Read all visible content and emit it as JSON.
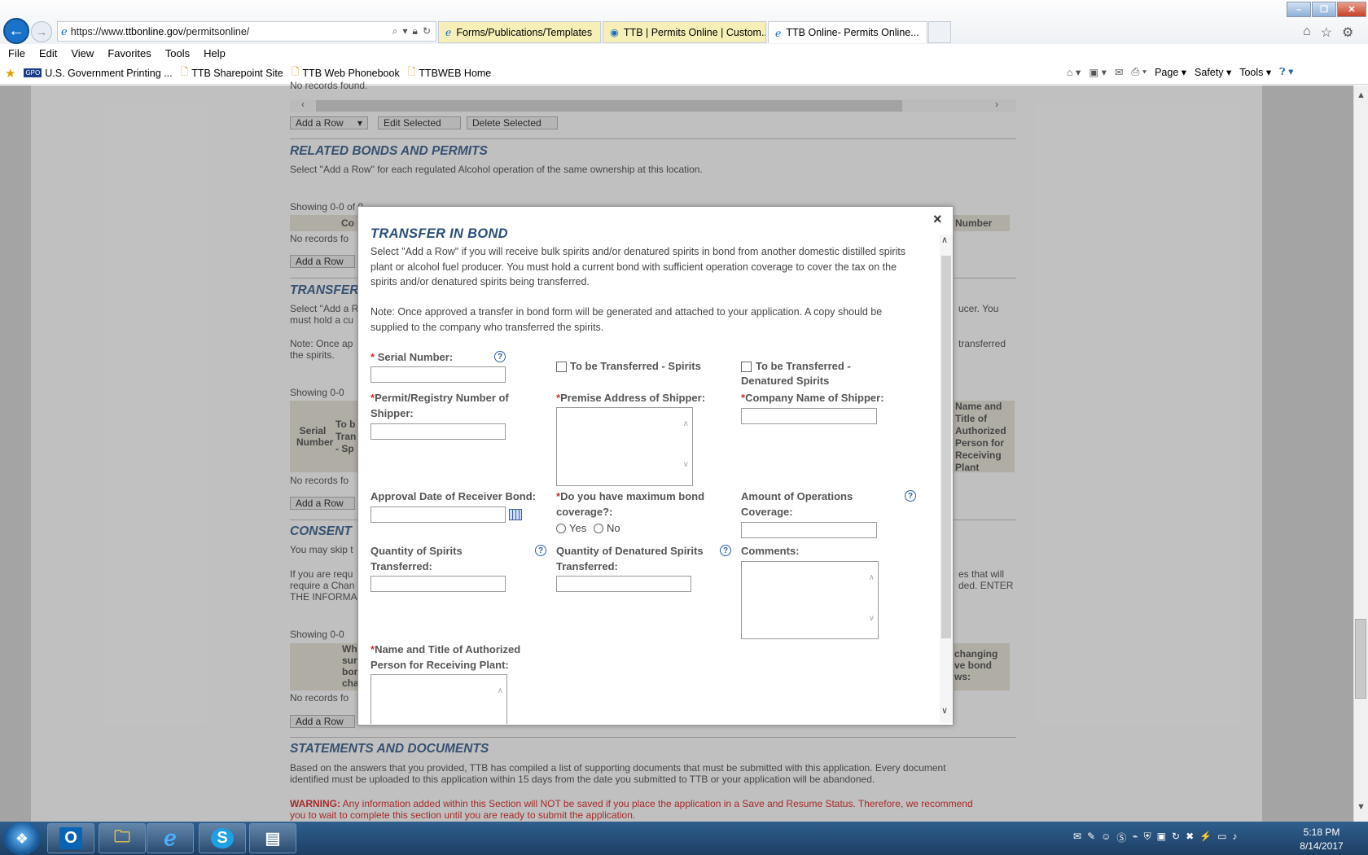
{
  "browser": {
    "url_prefix": "https://www.",
    "url_domain": "ttbonline.gov",
    "url_path": "/permitsonline/",
    "tabs": [
      "Forms/Publications/Templates",
      "TTB | Permits Online | Custom...",
      "TTB Online- Permits Online..."
    ],
    "menu": [
      "File",
      "Edit",
      "View",
      "Favorites",
      "Tools",
      "Help"
    ],
    "favorites": [
      "U.S. Government Printing ...",
      "TTB Sharepoint Site",
      "TTB Web Phonebook",
      "TTBWEB Home"
    ],
    "commands": [
      "Page",
      "Safety",
      "Tools"
    ]
  },
  "page": {
    "no_records_top": "No records found.",
    "btn_add_row": "Add a Row",
    "btn_edit_selected": "Edit Selected",
    "btn_delete_selected": "Delete Selected",
    "related_heading": "RELATED BONDS AND PERMITS",
    "related_desc": "Select \"Add a Row\" for each regulated Alcohol operation of the same ownership at this location.",
    "showing_0": "Showing 0-0 of 0",
    "showing_short": "Showing 0-0",
    "col_co": "Co",
    "col_number": "Number",
    "no_records_short": "No records fo",
    "transfer_heading": "TRANSFER",
    "transfer_desc_l1": "Select \"Add a R",
    "transfer_desc_l2": "must hold a cu",
    "transfer_right_1": "ucer. You",
    "note_l1": "Note: Once ap",
    "note_l2": "the spirits.",
    "note_right": "transferred",
    "col_serial": "Serial Number",
    "col_to_be_l1": "To b",
    "col_to_be_l2": "Tran",
    "col_to_be_l3": "- Sp",
    "col_name_title": "Name and Title of Authorized Person for Receiving Plant",
    "consent_heading": "CONSENT",
    "consent_l1": "You may skip t",
    "consent_l2": "If you are requ",
    "consent_l3": "require a Chan",
    "consent_l4": "THE INFORMA",
    "consent_right_1": "es that will",
    "consent_right_2": "ded. ENTER",
    "col_wh_1": "Wh",
    "col_wh_2": "sur",
    "col_wh_3": "bor",
    "col_wh_4": "cha",
    "col_changing_1": "changing",
    "col_changing_2": "ve bond",
    "col_changing_3": "ws:",
    "statements_heading": "STATEMENTS AND DOCUMENTS",
    "statements_l1": "Based on the answers that you provided, TTB has compiled a list of supporting documents that must be submitted with this application. Every document",
    "statements_l2": "identified must be uploaded to this application within 15 days from the date you submitted to TTB or your application will be abandoned.",
    "warning_label": "WARNING:",
    "warning_l1": " Any information added within this Section will NOT be saved if you place the application in a Save and Resume Status. Therefore, we recommend",
    "warning_l2": "you to wait to complete this section until you are ready to submit the application."
  },
  "modal": {
    "title": "TRANSFER IN BOND",
    "desc_l1": "Select \"Add a Row\" if you will receive bulk spirits and/or denatured spirits in bond from another domestic distilled spirits",
    "desc_l2": "plant or alcohol fuel producer. You must hold a current bond with sufficient operation coverage to cover the tax on the",
    "desc_l3": "spirits and/or denatured spirits being transferred.",
    "note_l1": "Note: Once approved a transfer in bond form will be generated and attached to your application. A copy should be",
    "note_l2": "supplied to the company who transferred the spirits.",
    "required_mark": "*",
    "serial_label": "Serial Number:",
    "to_be_spirits": "To be Transferred - Spirits",
    "to_be_denatured_l1": "To be Transferred -",
    "to_be_denatured_l2": "Denatured Spirits",
    "permit_label_l1": "Permit/Registry Number of",
    "permit_label_l2": "Shipper:",
    "premise_label": "Premise Address of Shipper:",
    "company_label": "Company Name of Shipper:",
    "approval_label": "Approval Date of Receiver Bond:",
    "max_bond_l1": "Do you have maximum bond",
    "max_bond_l2": "coverage?:",
    "yes": "Yes",
    "no": "No",
    "amount_l1": "Amount of Operations",
    "amount_l2": "Coverage:",
    "qty_spirits_l1": "Quantity of Spirits",
    "qty_spirits_l2": "Transferred:",
    "qty_denatured_l1": "Quantity of Denatured Spirits",
    "qty_denatured_l2": "Transferred:",
    "comments_label": "Comments:",
    "name_title_l1": "Name and Title of Authorized",
    "name_title_l2": "Person for Receiving Plant:",
    "close": "×",
    "help_glyph": "?"
  },
  "taskbar": {
    "time": "5:18 PM",
    "date": "8/14/2017"
  },
  "colors": {
    "heading_blue": "#44638a",
    "modal_title": "#2b4d7a",
    "required_red": "#cc3333",
    "help_blue": "#2b5fad"
  }
}
